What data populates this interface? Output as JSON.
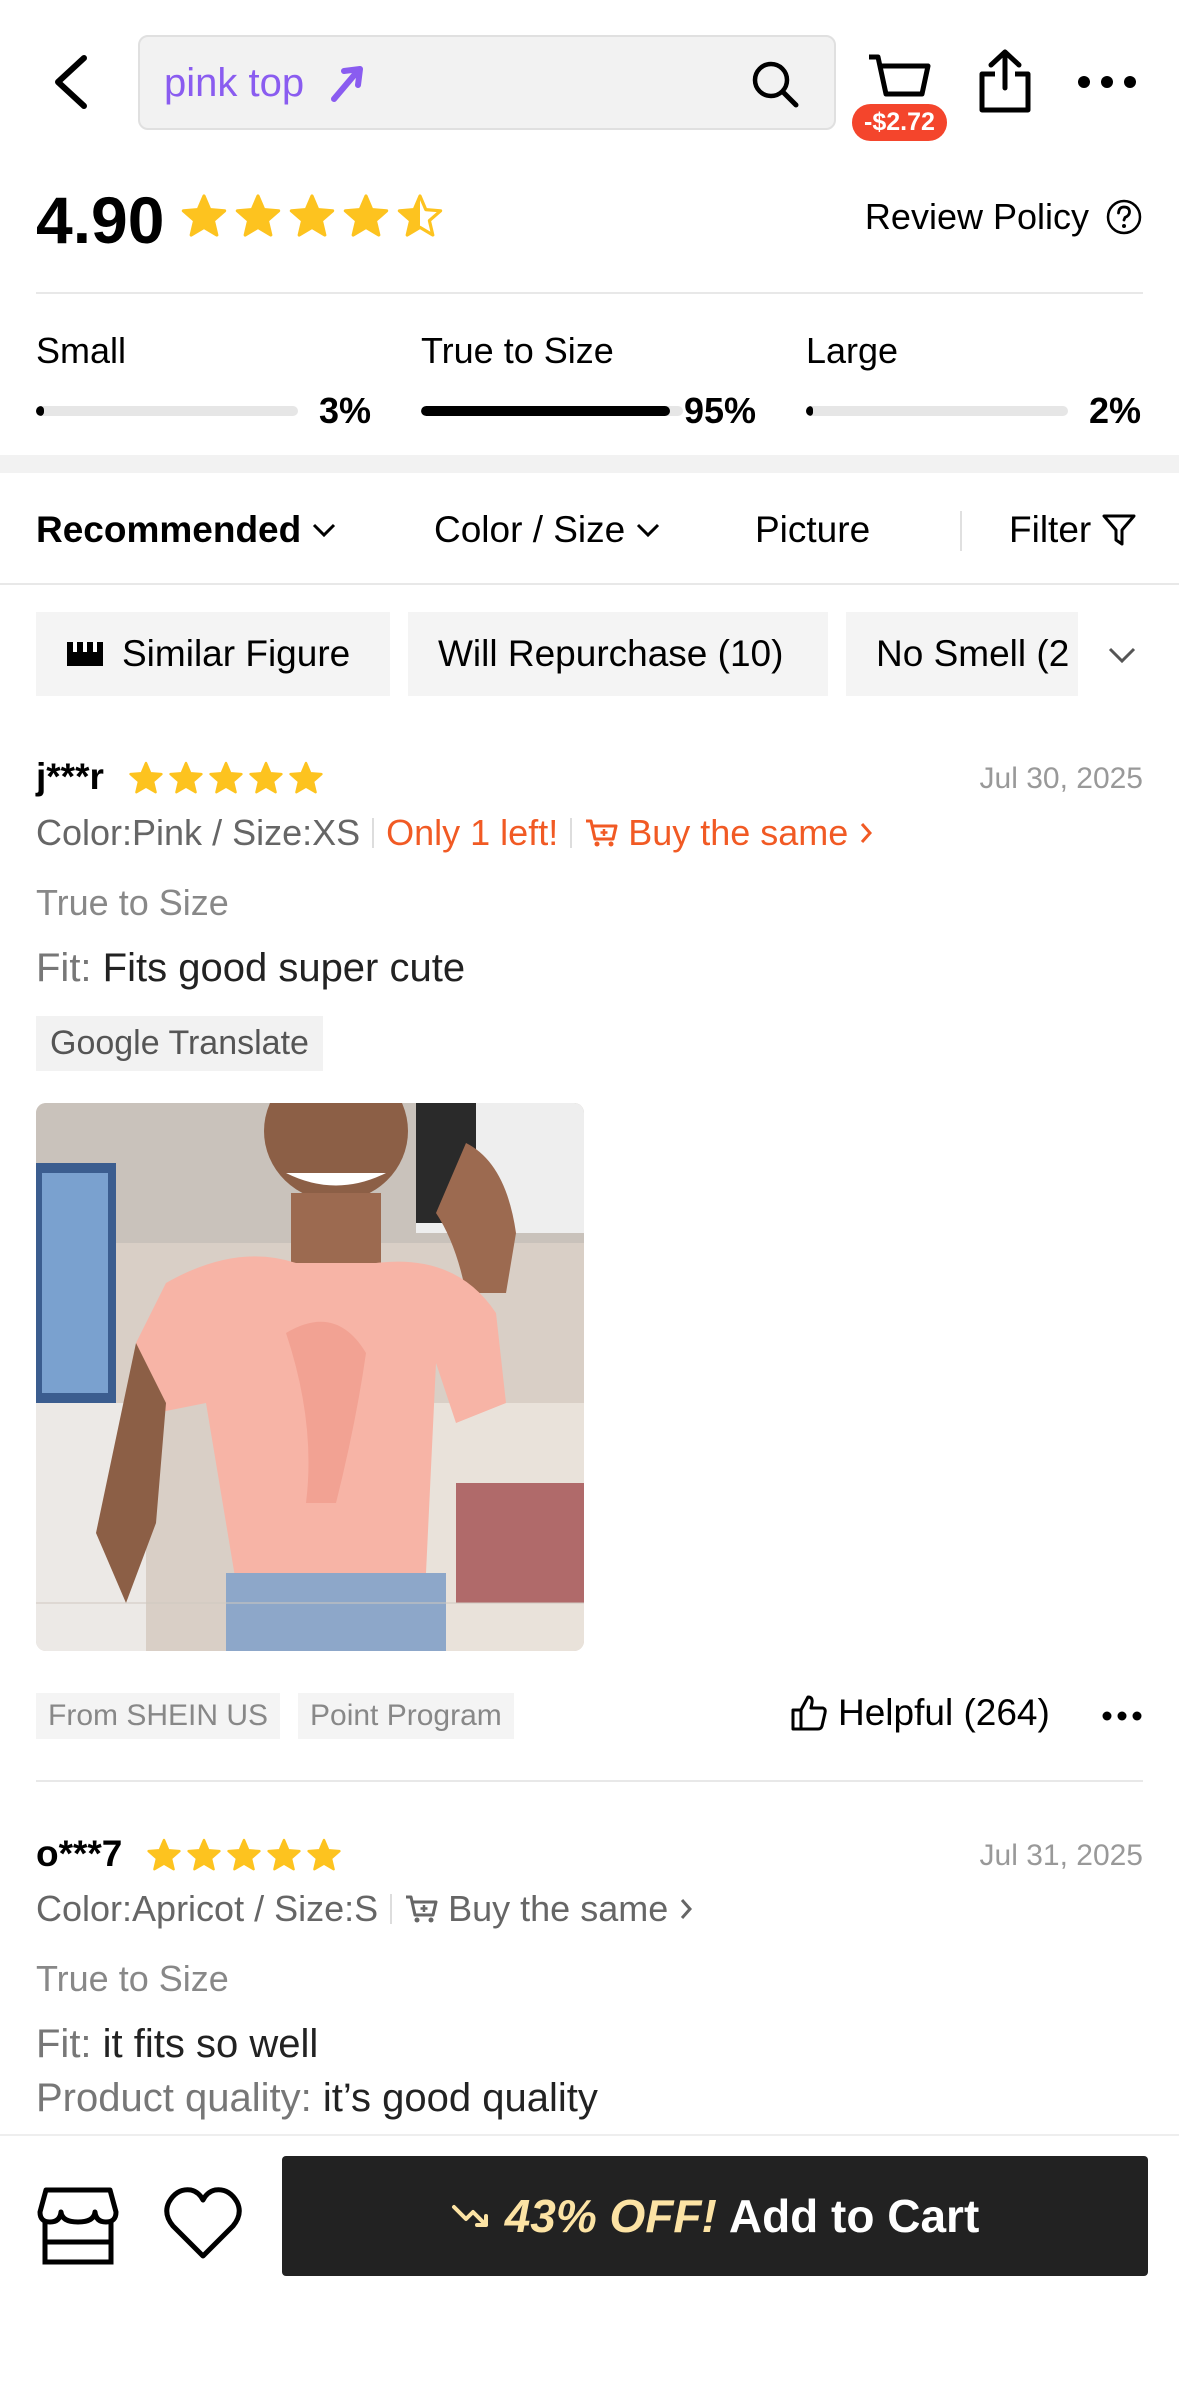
{
  "search": {
    "query": "pink top"
  },
  "cart": {
    "badge": "-$2.72"
  },
  "rating": {
    "score": "4.90",
    "stars": 4.5,
    "review_policy": "Review Policy"
  },
  "fit": [
    {
      "label": "Small",
      "percent": "3%",
      "value": 0.03
    },
    {
      "label": "True to Size",
      "percent": "95%",
      "value": 0.95
    },
    {
      "label": "Large",
      "percent": "2%",
      "value": 0.02
    }
  ],
  "sort": {
    "recommended": "Recommended",
    "color_size": "Color / Size",
    "picture": "Picture",
    "filter": "Filter"
  },
  "chips": [
    "Similar Figure",
    "Will Repurchase (10)",
    "No Smell (2"
  ],
  "reviews": [
    {
      "user": "j***r",
      "stars": 5,
      "date": "Jul 30, 2025",
      "variant": "Color:Pink / Size:XS",
      "stock": "Only 1 left!",
      "buy_same": "Buy the same",
      "fit": "True to Size",
      "fit_key": "Fit:",
      "fit_text": "Fits good super cute",
      "translate": "Google Translate",
      "tags": [
        "From SHEIN US",
        "Point Program"
      ],
      "helpful": "Helpful (264)"
    },
    {
      "user": "o***7",
      "stars": 5,
      "date": "Jul 31, 2025",
      "variant": "Color:Apricot / Size:S",
      "buy_same": "Buy the same",
      "fit": "True to Size",
      "fit_key": "Fit:",
      "fit_text": "it fits so well",
      "quality_key": "Product quality:",
      "quality_text": "it’s good quality"
    }
  ],
  "bottom": {
    "discount": "43% OFF!",
    "add_to_cart": "Add to Cart"
  },
  "colors": {
    "accent_orange": "#f15a24",
    "star": "#fdc31f",
    "search_purple": "#8a5cf0",
    "badge_red": "#f4452c"
  }
}
